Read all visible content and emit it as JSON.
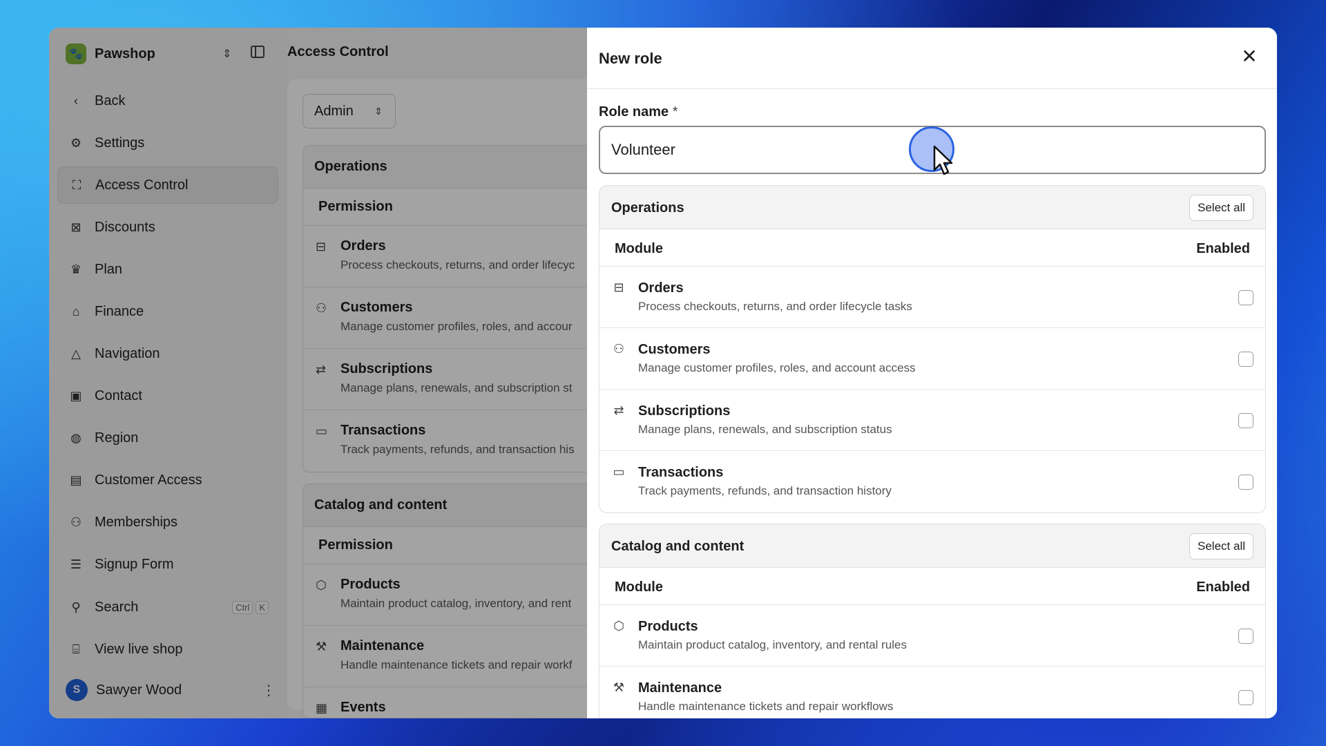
{
  "app": {
    "workspace": "Pawshop",
    "page_title": "Access Control"
  },
  "sidebar": {
    "items": [
      {
        "label": "Back",
        "icon": "chevron-left-icon"
      },
      {
        "label": "Settings",
        "icon": "gear-icon"
      },
      {
        "label": "Access Control",
        "icon": "scan-user-icon",
        "active": true
      },
      {
        "label": "Discounts",
        "icon": "discount-icon"
      },
      {
        "label": "Plan",
        "icon": "crown-icon"
      },
      {
        "label": "Finance",
        "icon": "bank-icon"
      },
      {
        "label": "Navigation",
        "icon": "navigation-icon"
      },
      {
        "label": "Contact",
        "icon": "contact-icon"
      },
      {
        "label": "Region",
        "icon": "globe-icon"
      },
      {
        "label": "Customer Access",
        "icon": "id-card-icon"
      },
      {
        "label": "Memberships",
        "icon": "users-icon"
      },
      {
        "label": "Signup Form",
        "icon": "form-icon"
      }
    ],
    "search": {
      "label": "Search",
      "kbd": [
        "Ctrl",
        "K"
      ]
    },
    "view_live": "View live shop",
    "user": {
      "initial": "S",
      "name": "Sawyer Wood"
    }
  },
  "background": {
    "role_selector": "Admin",
    "operations": {
      "title": "Operations",
      "column": "Permission",
      "rows": [
        {
          "title": "Orders",
          "desc": "Process checkouts, returns, and order lifecyc"
        },
        {
          "title": "Customers",
          "desc": "Manage customer profiles, roles, and accour"
        },
        {
          "title": "Subscriptions",
          "desc": "Manage plans, renewals, and subscription st"
        },
        {
          "title": "Transactions",
          "desc": "Track payments, refunds, and transaction his"
        }
      ]
    },
    "catalog": {
      "title": "Catalog and content",
      "column": "Permission",
      "rows": [
        {
          "title": "Products",
          "desc": "Maintain product catalog, inventory, and rent"
        },
        {
          "title": "Maintenance",
          "desc": "Handle maintenance tickets and repair workf"
        },
        {
          "title": "Events",
          "desc": ""
        }
      ]
    }
  },
  "drawer": {
    "title": "New role",
    "role_name_label": "Role name",
    "required_mark": "*",
    "role_name_value": "Volunteer",
    "select_all": "Select all",
    "module_header": "Module",
    "enabled_header": "Enabled",
    "operations": {
      "title": "Operations",
      "rows": [
        {
          "title": "Orders",
          "desc": "Process checkouts, returns, and order lifecycle tasks",
          "icon": "inbox-icon",
          "enabled": false
        },
        {
          "title": "Customers",
          "desc": "Manage customer profiles, roles, and account access",
          "icon": "users-icon",
          "enabled": false
        },
        {
          "title": "Subscriptions",
          "desc": "Manage plans, renewals, and subscription status",
          "icon": "repeat-icon",
          "enabled": false
        },
        {
          "title": "Transactions",
          "desc": "Track payments, refunds, and transaction history",
          "icon": "credit-card-icon",
          "enabled": false
        }
      ]
    },
    "catalog": {
      "title": "Catalog and content",
      "rows": [
        {
          "title": "Products",
          "desc": "Maintain product catalog, inventory, and rental rules",
          "icon": "box-icon",
          "enabled": false
        },
        {
          "title": "Maintenance",
          "desc": "Handle maintenance tickets and repair workflows",
          "icon": "wrench-icon",
          "enabled": false
        }
      ]
    }
  },
  "colors": {
    "accent": "#2a62e0",
    "avatar": "#1f5fd6",
    "workspace_logo": "#7fb241"
  }
}
